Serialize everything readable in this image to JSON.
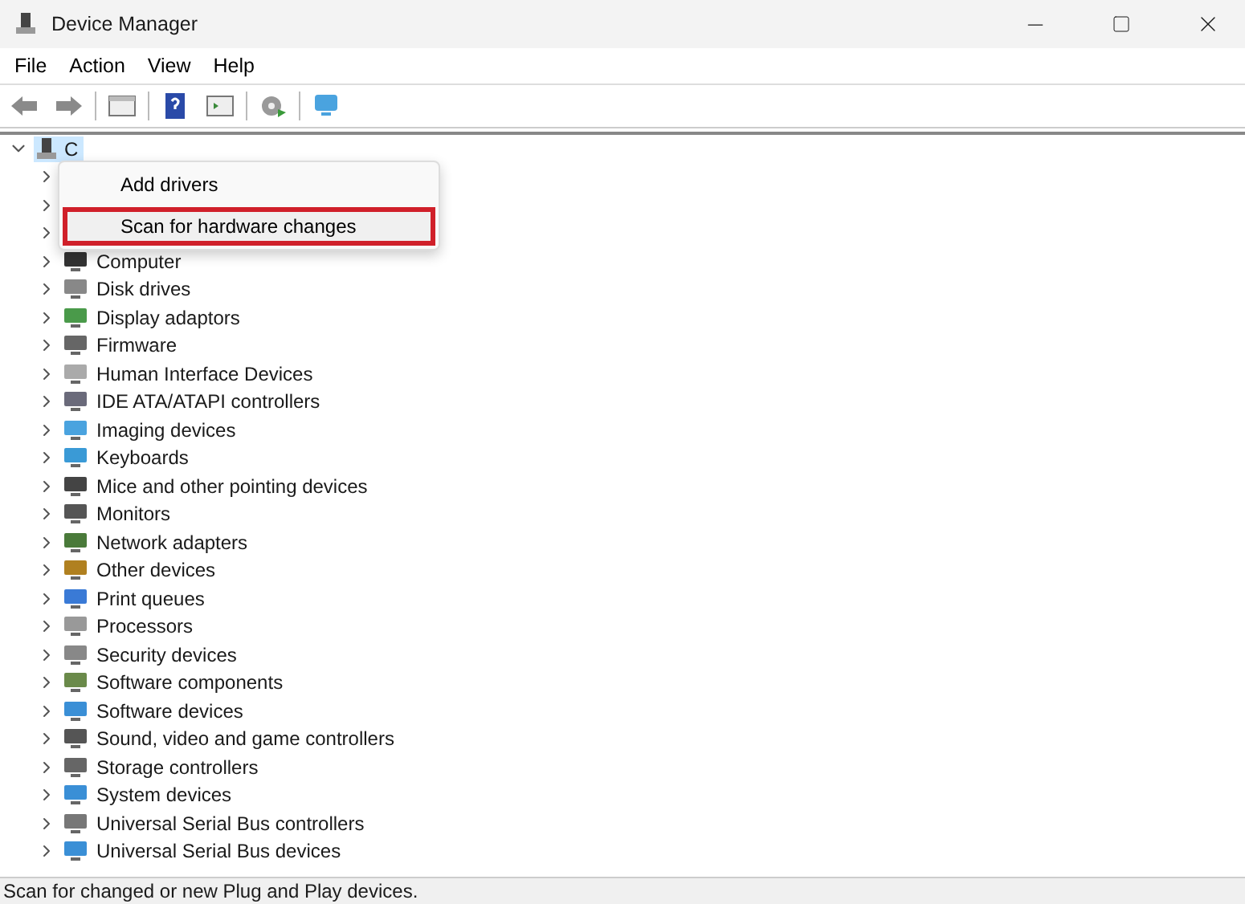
{
  "window": {
    "title": "Device Manager"
  },
  "menu_bar": [
    "File",
    "Action",
    "View",
    "Help"
  ],
  "tree": {
    "root": {
      "label": "C",
      "expanded": true,
      "selected": true
    },
    "children": [
      {
        "kind": "covered"
      },
      {
        "kind": "covered"
      },
      {
        "kind": "covered"
      },
      {
        "kind": "item",
        "label": "Computer"
      },
      {
        "kind": "item",
        "label": "Disk drives"
      },
      {
        "kind": "item",
        "label": "Display adaptors"
      },
      {
        "kind": "item",
        "label": "Firmware"
      },
      {
        "kind": "item",
        "label": "Human Interface Devices"
      },
      {
        "kind": "item",
        "label": "IDE ATA/ATAPI controllers"
      },
      {
        "kind": "item",
        "label": "Imaging devices"
      },
      {
        "kind": "item",
        "label": "Keyboards"
      },
      {
        "kind": "item",
        "label": "Mice and other pointing devices"
      },
      {
        "kind": "item",
        "label": "Monitors"
      },
      {
        "kind": "item",
        "label": "Network adapters"
      },
      {
        "kind": "item",
        "label": "Other devices"
      },
      {
        "kind": "item",
        "label": "Print queues"
      },
      {
        "kind": "item",
        "label": "Processors"
      },
      {
        "kind": "item",
        "label": "Security devices"
      },
      {
        "kind": "item",
        "label": "Software components"
      },
      {
        "kind": "item",
        "label": "Software devices"
      },
      {
        "kind": "item",
        "label": "Sound, video and game controllers"
      },
      {
        "kind": "item",
        "label": "Storage controllers"
      },
      {
        "kind": "item",
        "label": "System devices"
      },
      {
        "kind": "item",
        "label": "Universal Serial Bus controllers"
      },
      {
        "kind": "item",
        "label": "Universal Serial Bus devices"
      }
    ]
  },
  "context_menu": [
    {
      "label": "Add drivers",
      "highlighted": false
    },
    {
      "label": "Scan for hardware changes",
      "highlighted": true
    }
  ],
  "status_bar": "Scan for changed or new Plug and Play devices."
}
